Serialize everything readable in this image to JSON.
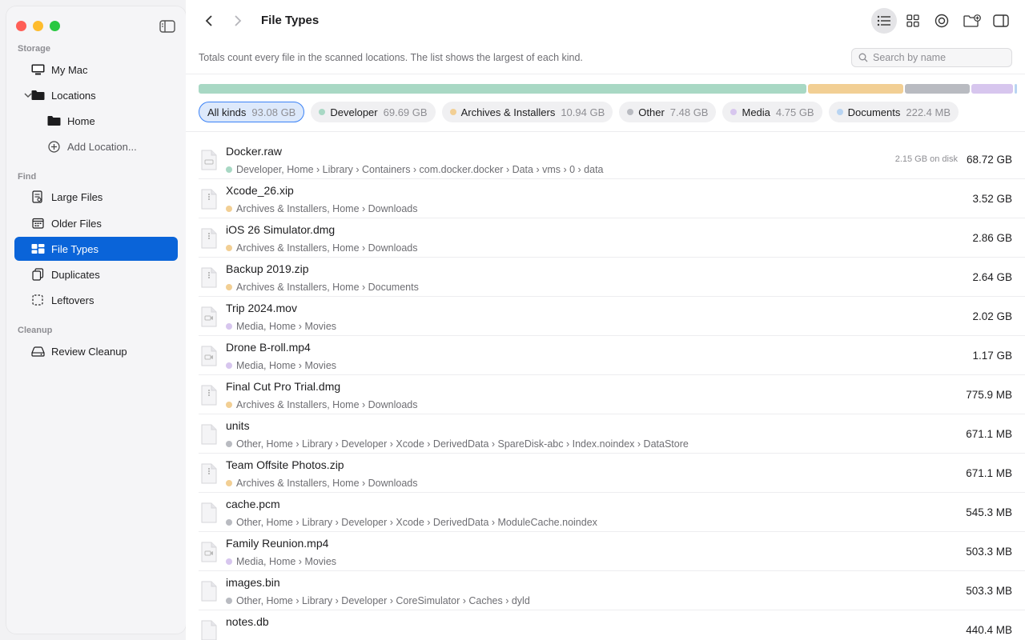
{
  "sidebar": {
    "sections": {
      "storage": "Storage",
      "find": "Find",
      "cleanup": "Cleanup"
    },
    "items": [
      {
        "label": "My Mac",
        "icon": "display-icon"
      },
      {
        "label": "Locations",
        "icon": "folder-icon"
      },
      {
        "label": "Home",
        "icon": "folder-icon"
      },
      {
        "label": "Add Location...",
        "icon": "plus-circle-icon"
      },
      {
        "label": "Large Files",
        "icon": "doc-icon"
      },
      {
        "label": "Older Files",
        "icon": "calendar-icon"
      },
      {
        "label": "File Types",
        "icon": "grid-icon"
      },
      {
        "label": "Duplicates",
        "icon": "duplicate-icon"
      },
      {
        "label": "Leftovers",
        "icon": "dashed-square-icon"
      },
      {
        "label": "Review Cleanup",
        "icon": "disk-icon"
      }
    ]
  },
  "header": {
    "title": "File Types",
    "subtitle": "Totals count every file in the scanned locations. The list shows the largest of each kind.",
    "search_placeholder": "Search by name"
  },
  "colors": {
    "developer": "#a8d8c4",
    "archives": "#f2cf94",
    "other": "#b9bbc1",
    "media": "#d7c6ee",
    "documents": "#b8d4f2",
    "accent": "#0a64d9"
  },
  "usage_bar": [
    {
      "kind": "developer",
      "fraction": 0.7487
    },
    {
      "kind": "archives",
      "fraction": 0.1175
    },
    {
      "kind": "other",
      "fraction": 0.0804
    },
    {
      "kind": "media",
      "fraction": 0.051
    },
    {
      "kind": "documents",
      "fraction": 0.0024
    }
  ],
  "chips": [
    {
      "label": "All kinds",
      "size": "93.08 GB",
      "kind": "all"
    },
    {
      "label": "Developer",
      "size": "69.69 GB",
      "kind": "developer"
    },
    {
      "label": "Archives & Installers",
      "size": "10.94 GB",
      "kind": "archives"
    },
    {
      "label": "Other",
      "size": "7.48 GB",
      "kind": "other"
    },
    {
      "label": "Media",
      "size": "4.75 GB",
      "kind": "media"
    },
    {
      "label": "Documents",
      "size": "222.4 MB",
      "kind": "documents"
    }
  ],
  "files": [
    {
      "name": "Docker.raw",
      "kind": "developer",
      "path": "Developer, Home › Library › Containers › com.docker.docker › Data › vms › 0 › data",
      "size": "68.72 GB",
      "ondisk": "2.15 GB on disk"
    },
    {
      "name": "Xcode_26.xip",
      "kind": "archives",
      "path": "Archives & Installers, Home › Downloads",
      "size": "3.52 GB"
    },
    {
      "name": "iOS 26 Simulator.dmg",
      "kind": "archives",
      "path": "Archives & Installers, Home › Downloads",
      "size": "2.86 GB"
    },
    {
      "name": "Backup 2019.zip",
      "kind": "archives",
      "path": "Archives & Installers, Home › Documents",
      "size": "2.64 GB"
    },
    {
      "name": "Trip 2024.mov",
      "kind": "media",
      "path": "Media, Home › Movies",
      "size": "2.02 GB"
    },
    {
      "name": "Drone B-roll.mp4",
      "kind": "media",
      "path": "Media, Home › Movies",
      "size": "1.17 GB"
    },
    {
      "name": "Final Cut Pro Trial.dmg",
      "kind": "archives",
      "path": "Archives & Installers, Home › Downloads",
      "size": "775.9 MB"
    },
    {
      "name": "units",
      "kind": "other",
      "path": "Other, Home › Library › Developer › Xcode › DerivedData › SpareDisk-abc › Index.noindex › DataStore",
      "size": "671.1 MB"
    },
    {
      "name": "Team Offsite Photos.zip",
      "kind": "archives",
      "path": "Archives & Installers, Home › Downloads",
      "size": "671.1 MB"
    },
    {
      "name": "cache.pcm",
      "kind": "other",
      "path": "Other, Home › Library › Developer › Xcode › DerivedData › ModuleCache.noindex",
      "size": "545.3 MB"
    },
    {
      "name": "Family Reunion.mp4",
      "kind": "media",
      "path": "Media, Home › Movies",
      "size": "503.3 MB"
    },
    {
      "name": "images.bin",
      "kind": "other",
      "path": "Other, Home › Library › Developer › CoreSimulator › Caches › dyld",
      "size": "503.3 MB"
    },
    {
      "name": "notes.db",
      "kind": "other",
      "path": "",
      "size": "440.4 MB"
    }
  ]
}
